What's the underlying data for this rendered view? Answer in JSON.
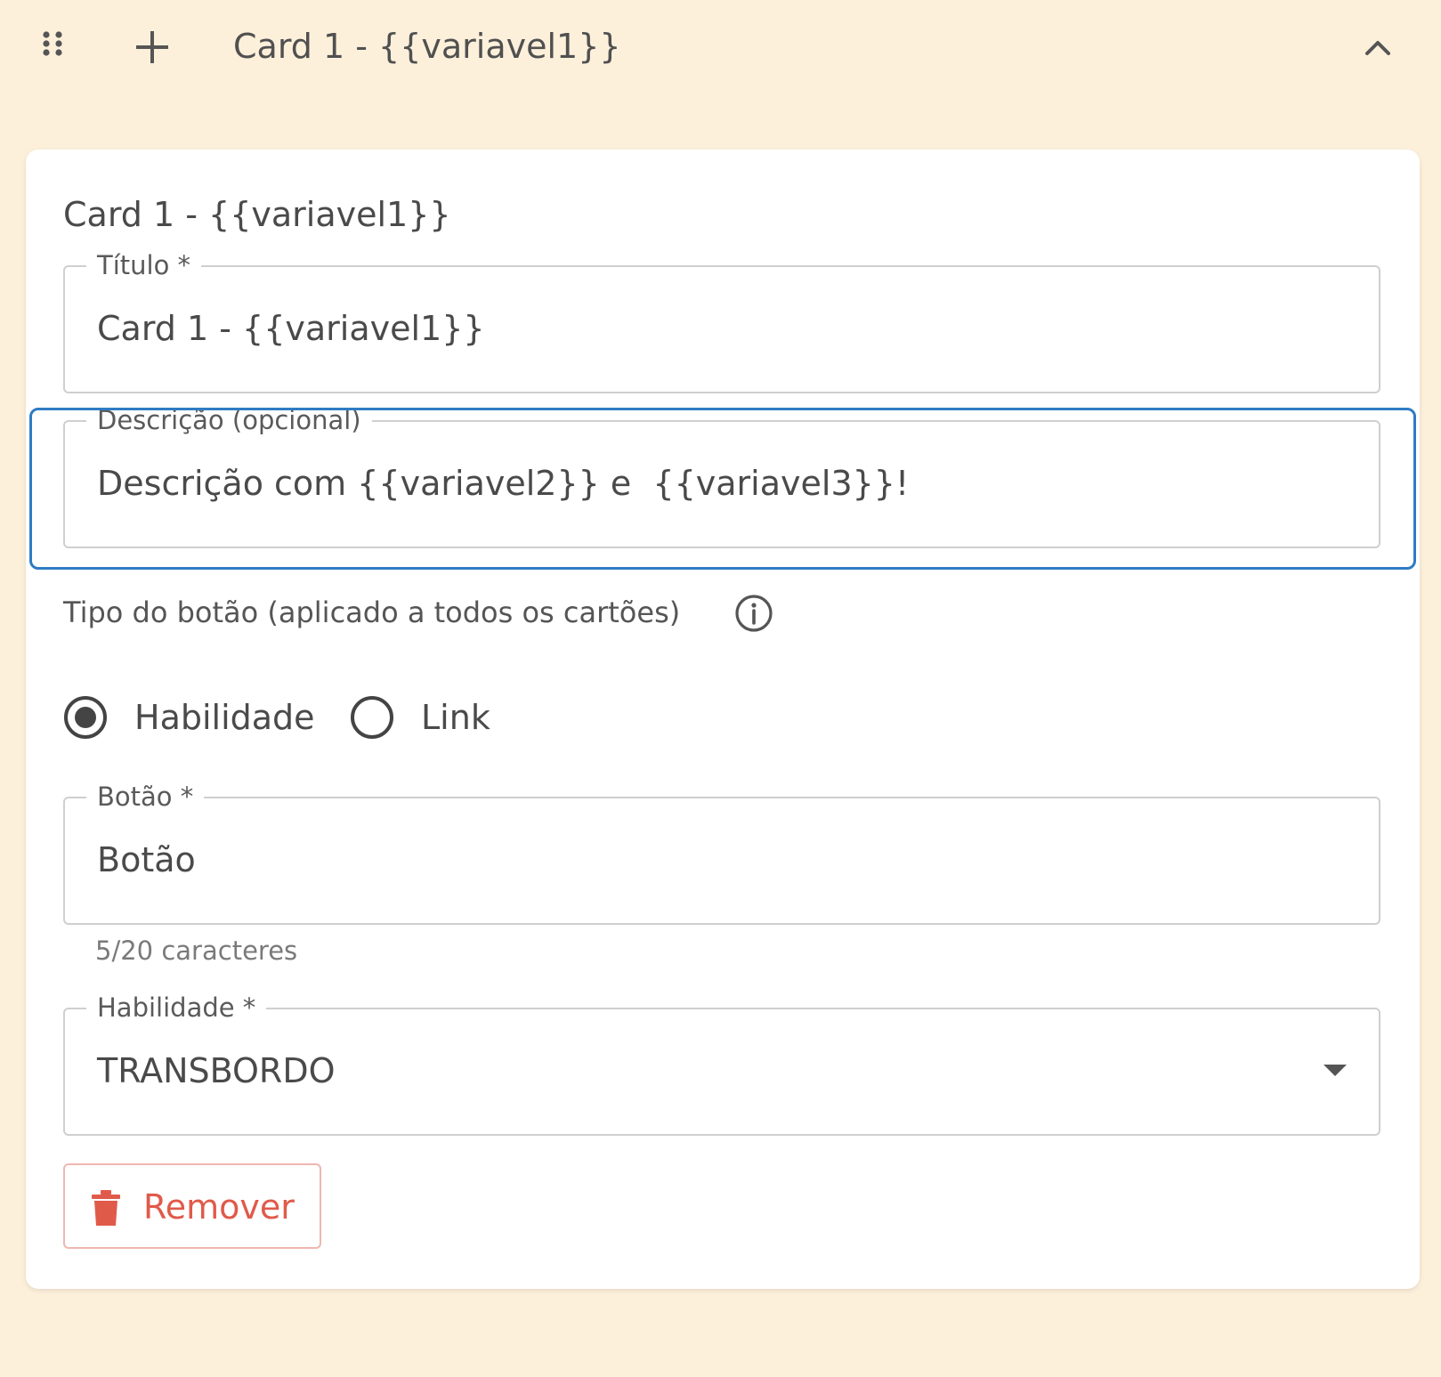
{
  "header": {
    "title": "Card 1 - {{variavel1}}",
    "drag_icon": "drag-handle-icon",
    "add_icon": "plus-icon",
    "collapse_icon": "chevron-up-icon"
  },
  "card": {
    "title": "Card 1 - {{variavel1}}",
    "fields": {
      "titulo": {
        "label": "Título *",
        "value": "Card 1 - {{variavel1}}"
      },
      "descricao": {
        "label": "Descrição (opcional)",
        "value": "Descrição com {{variavel2}} e  {{variavel3}}!"
      },
      "botao": {
        "label": "Botão *",
        "value": "Botão",
        "helper": "5/20 caracteres"
      },
      "habilidade": {
        "label": "Habilidade *",
        "selected": "TRANSBORDO"
      }
    },
    "button_type": {
      "label": "Tipo do botão (aplicado a todos os cartões)",
      "info_icon": "info-icon",
      "options": [
        {
          "label": "Habilidade",
          "selected": true
        },
        {
          "label": "Link",
          "selected": false
        }
      ]
    },
    "remove_button": {
      "label": "Remover",
      "icon": "trash-icon"
    }
  },
  "colors": {
    "background": "#fdf0db",
    "card": "#ffffff",
    "focus": "#2f7bc4",
    "danger": "#e05a4a",
    "danger_border": "#f0b7b0",
    "text": "#4a4a4a"
  }
}
